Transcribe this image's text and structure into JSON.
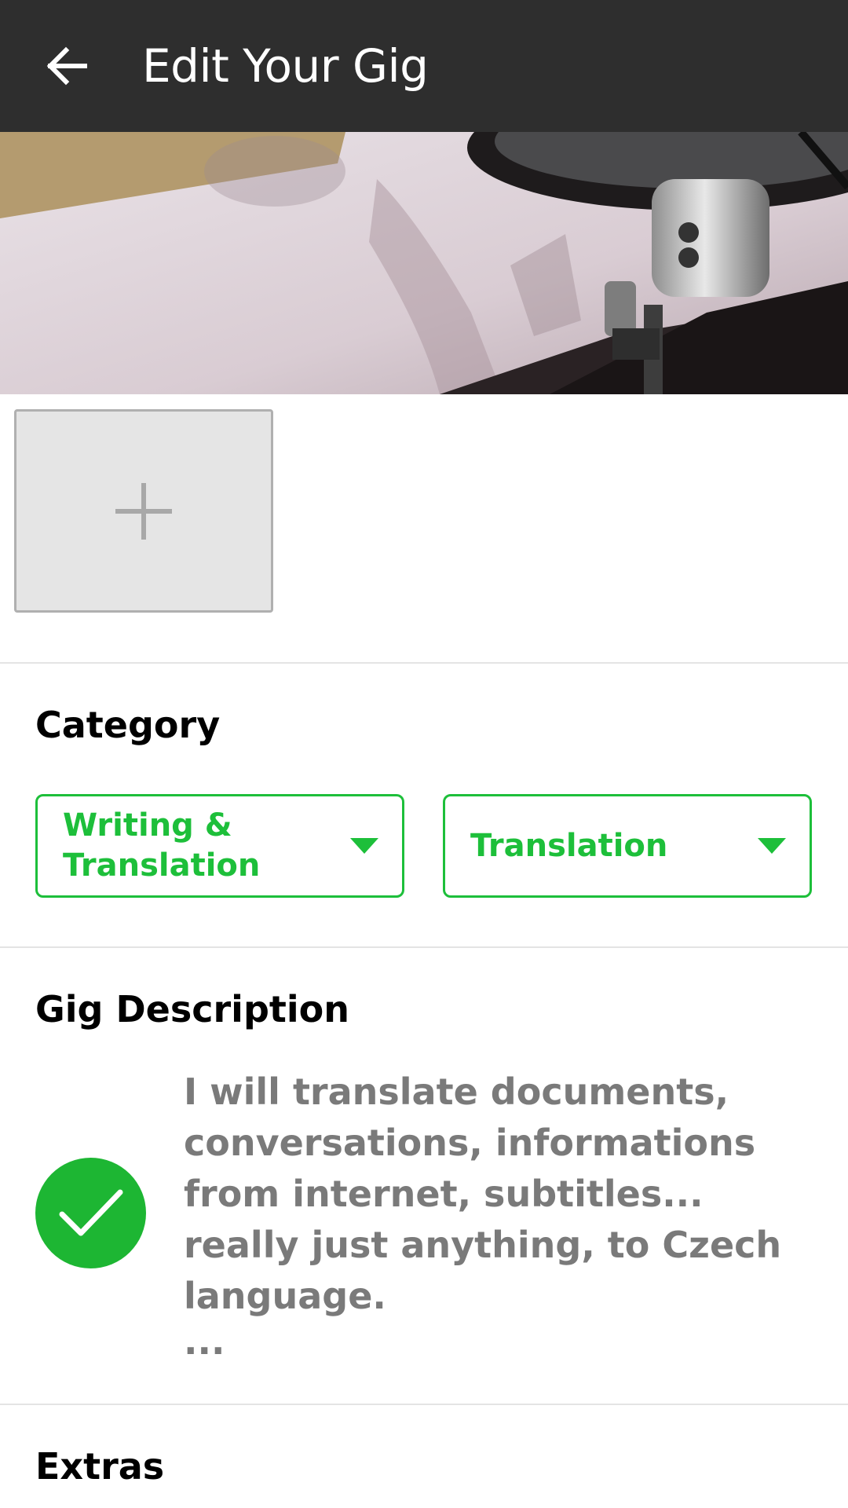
{
  "header": {
    "title": "Edit Your Gig",
    "back_icon": "arrow-left-icon"
  },
  "gallery": {
    "add_icon": "plus-icon"
  },
  "category": {
    "title": "Category",
    "main_line1": "Writing &",
    "main_line2": "Translation",
    "sub": "Translation",
    "accent_color": "#1dbf3a"
  },
  "description": {
    "title": "Gig Description",
    "text": "I will translate documents, conversations, informations from internet, subtitles... really just anything, to Czech language.",
    "more": "...",
    "status_icon": "check-circle-icon"
  },
  "extras": {
    "title": "Extras"
  }
}
